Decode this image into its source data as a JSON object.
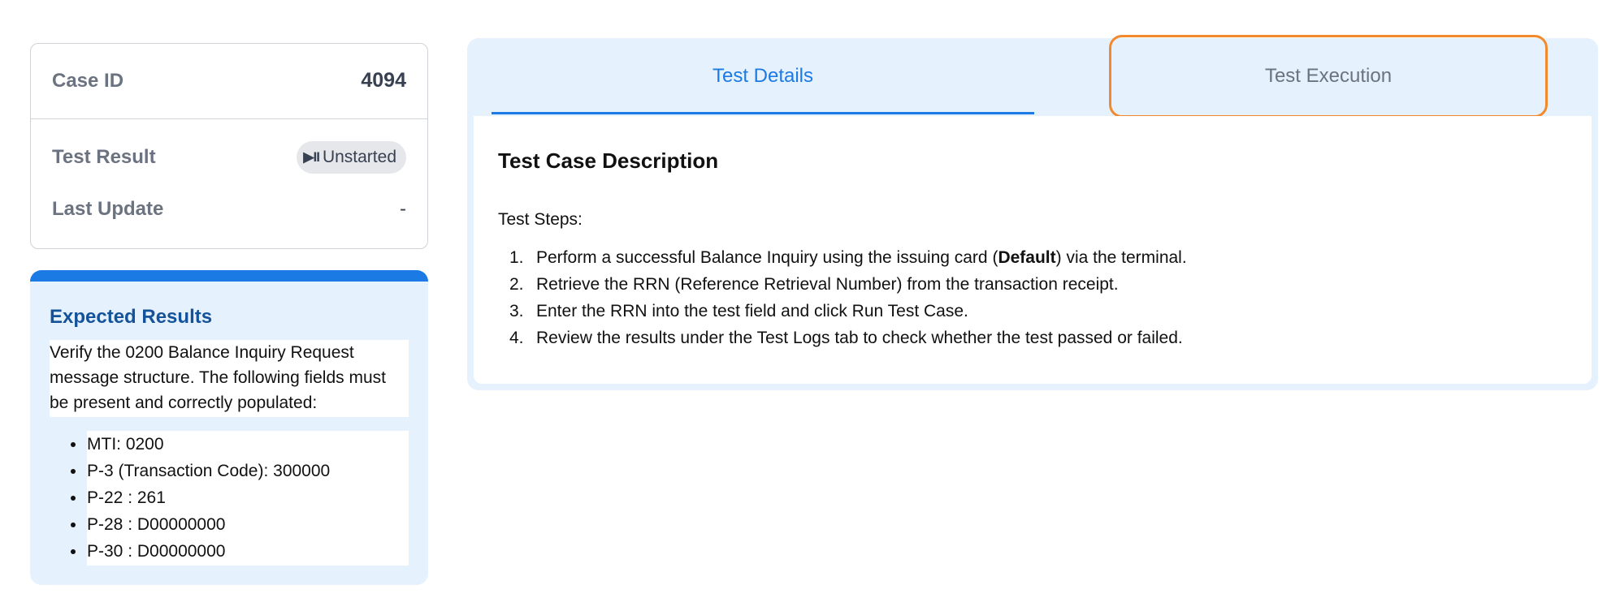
{
  "case_info": {
    "case_id_label": "Case ID",
    "case_id_value": "4094",
    "test_result_label": "Test Result",
    "test_result_icon": "play-pause-icon",
    "test_result_glyph": "▶II",
    "test_result_value": "Unstarted",
    "last_update_label": "Last Update",
    "last_update_value": "-"
  },
  "expected_results": {
    "title": "Expected Results",
    "description": "Verify the 0200 Balance Inquiry Request message structure. The following fields must be present and correctly populated:",
    "fields": [
      "MTI: 0200",
      "P-3 (Transaction Code): 300000",
      "P-22 : 261",
      "P-28 : D00000000",
      "P-30 : D00000000"
    ]
  },
  "tabs": {
    "details": "Test Details",
    "execution": "Test Execution",
    "active": "details"
  },
  "details": {
    "title": "Test Case Description",
    "steps_label": "Test Steps:",
    "steps": [
      {
        "num": "1.",
        "before": "Perform a successful Balance Inquiry using the issuing card (",
        "bold": "Default",
        "after": ") via the terminal."
      },
      {
        "num": "2.",
        "before": "Retrieve the RRN (Reference Retrieval Number) from the transaction receipt.",
        "bold": "",
        "after": ""
      },
      {
        "num": "3.",
        "before": "Enter the RRN into the test field and click Run Test Case.",
        "bold": "",
        "after": ""
      },
      {
        "num": "4.",
        "before": "Review the results under the Test Logs tab to check whether the test passed or failed.",
        "bold": "",
        "after": ""
      }
    ]
  },
  "colors": {
    "accent": "#1c7ae4",
    "panel_bg": "#e5f1fc",
    "highlight": "#f28a2d",
    "expected_title": "#14539a"
  }
}
